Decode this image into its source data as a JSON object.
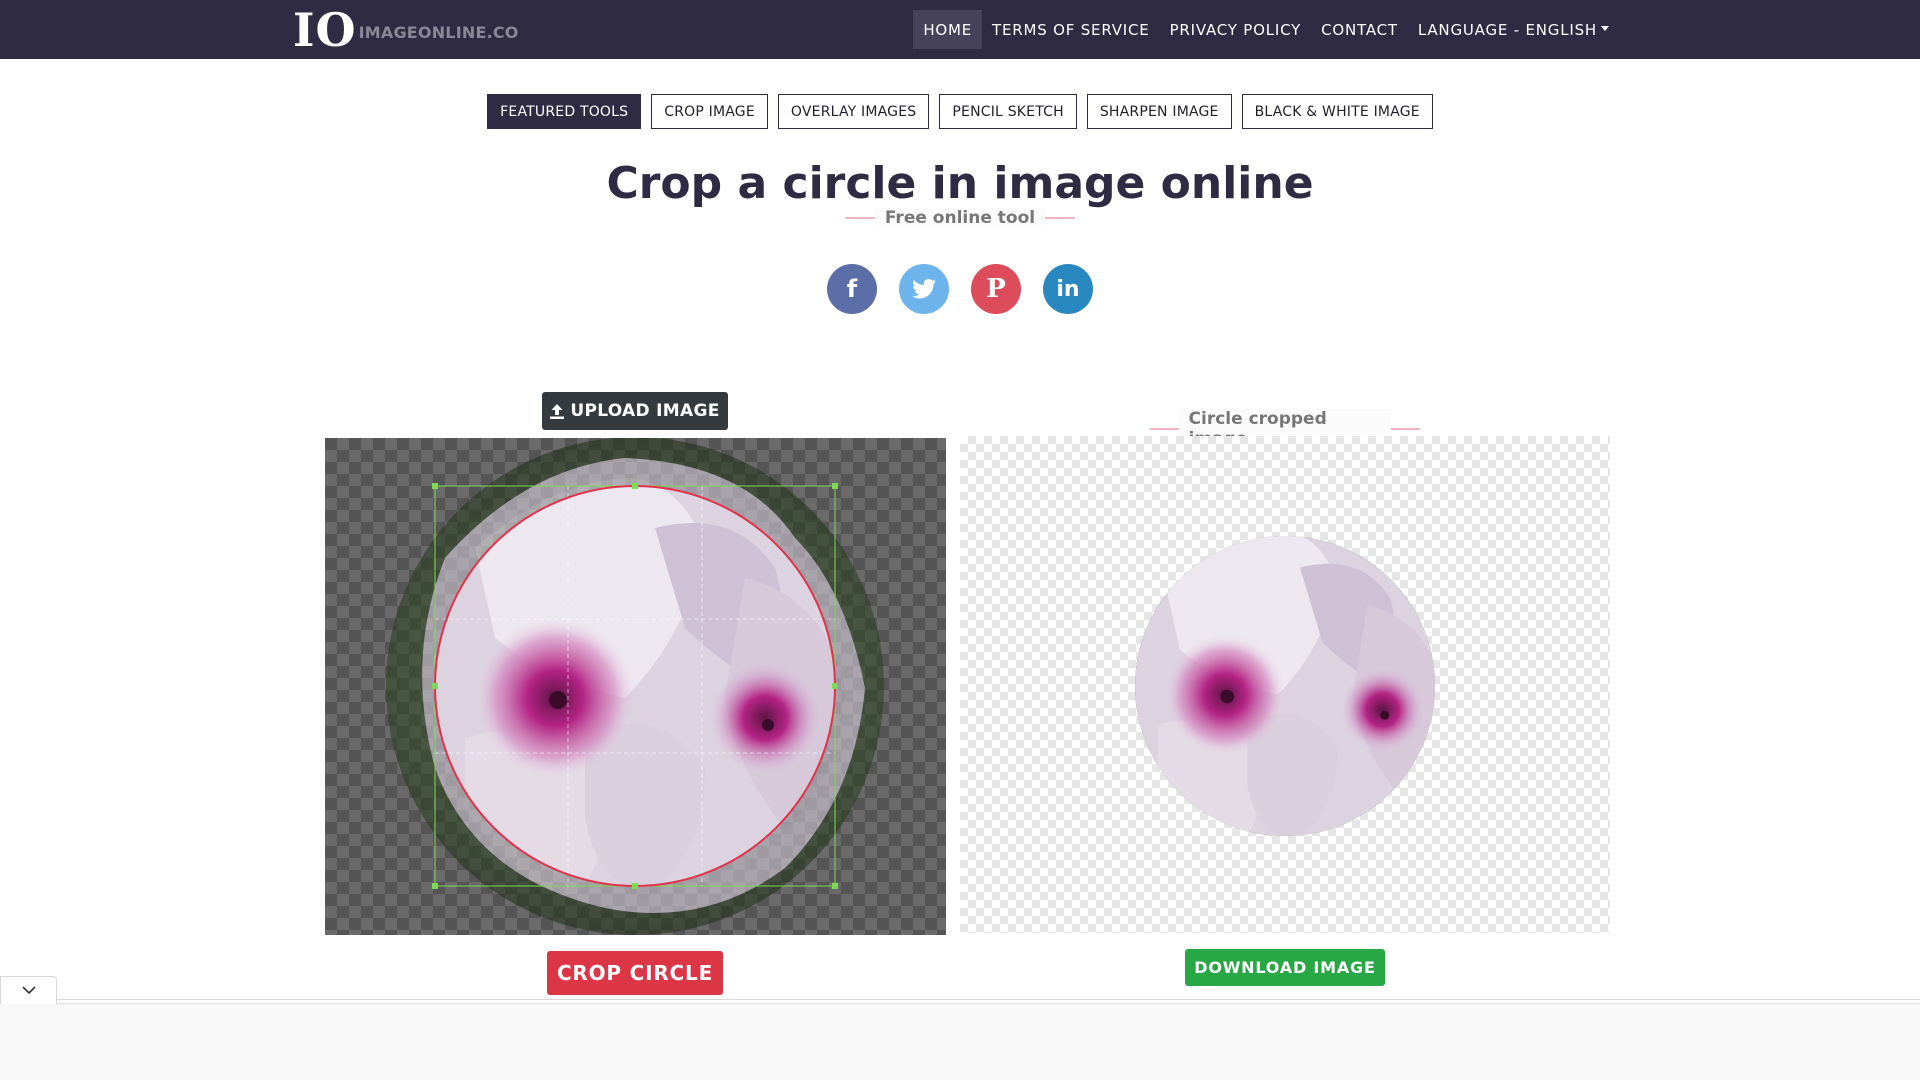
{
  "navbar": {
    "logo_mark": "IO",
    "logo_text": "IMAGEONLINE.CO",
    "links": [
      "HOME",
      "TERMS OF SERVICE",
      "PRIVACY POLICY",
      "CONTACT"
    ],
    "language": "LANGUAGE - ENGLISH"
  },
  "tool_tabs": [
    "FEATURED TOOLS",
    "CROP IMAGE",
    "OVERLAY IMAGES",
    "PENCIL SKETCH",
    "SHARPEN IMAGE",
    "BLACK & WHITE IMAGE"
  ],
  "page": {
    "title": "Crop a circle in image online",
    "subtitle": "Free online tool"
  },
  "social": {
    "facebook": "f",
    "twitter": "twitter-icon",
    "pinterest": "P",
    "linkedin": "in"
  },
  "editor": {
    "upload_label": "UPLOAD IMAGE",
    "crop_label": "CROP CIRCLE"
  },
  "result": {
    "label": "Circle cropped image",
    "download_label": "DOWNLOAD IMAGE"
  },
  "colors": {
    "navbar": "#2e2b43",
    "crop_button": "#dc3545",
    "download_button": "#28a745",
    "crop_circle_outline": "#e0344a",
    "crop_handles": "#7ed957"
  }
}
